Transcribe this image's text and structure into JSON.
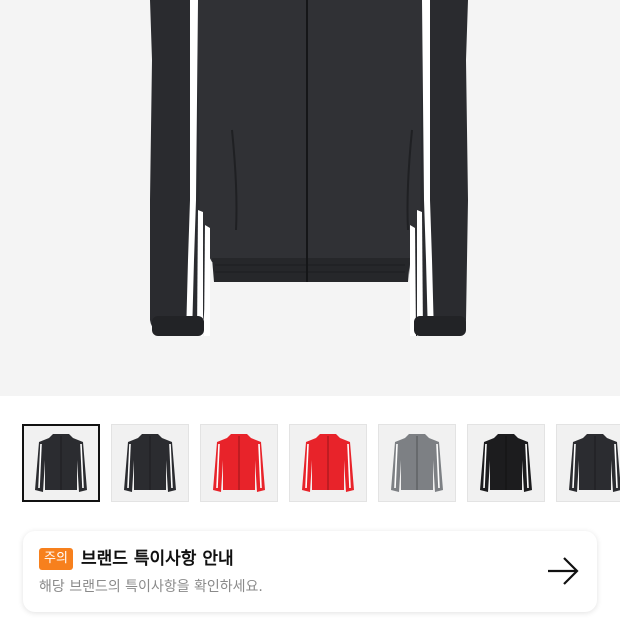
{
  "product": {
    "main_image": "black-track-jacket-photo",
    "thumbnails": [
      {
        "image": "black-jacket-thumbnail",
        "body_color": "#2b2c30",
        "stripe_color": "#ffffff",
        "selected": true
      },
      {
        "image": "black-jacket-thumbnail",
        "body_color": "#2b2c30",
        "stripe_color": "#ffffff",
        "selected": false
      },
      {
        "image": "red-jacket-thumbnail",
        "body_color": "#e8232a",
        "stripe_color": "#ffffff",
        "selected": false
      },
      {
        "image": "red-jacket-thumbnail",
        "body_color": "#e8232a",
        "stripe_color": "#ffffff",
        "selected": false
      },
      {
        "image": "grey-jacket-thumbnail",
        "body_color": "#7d8084",
        "stripe_color": "#ffffff",
        "selected": false
      },
      {
        "image": "black-jacket-thumbnail",
        "body_color": "#1c1c1e",
        "stripe_color": "#ffffff",
        "selected": false
      },
      {
        "image": "black-jacket-thumbnail",
        "body_color": "#2b2c30",
        "stripe_color": "#ffffff",
        "selected": false
      }
    ]
  },
  "notice": {
    "badge": "주의",
    "title": "브랜드 특이사항 안내",
    "subtitle": "해당 브랜드의 특이사항을 확인하세요.",
    "arrow_icon": "arrow-right-icon"
  },
  "colors": {
    "badge_bg": "#f7801d",
    "hero_bg": "#f4f4f4"
  }
}
